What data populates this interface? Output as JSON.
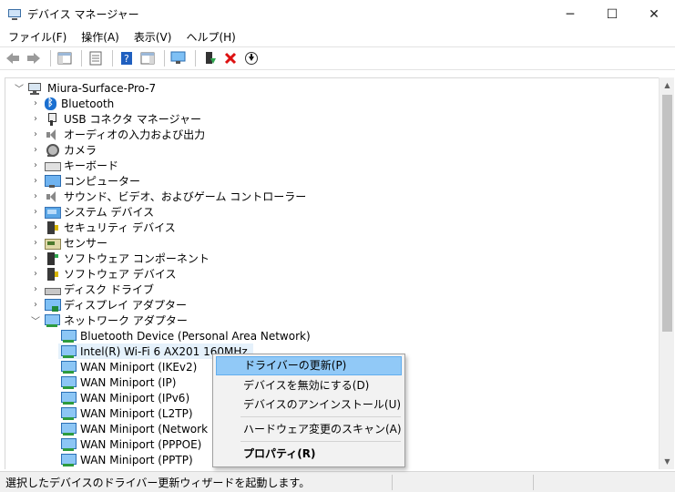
{
  "window": {
    "title": "デバイス マネージャー",
    "minimize": "─",
    "maximize": "☐",
    "close": "✕"
  },
  "menubar": [
    "ファイル(F)",
    "操作(A)",
    "表示(V)",
    "ヘルプ(H)"
  ],
  "toolbar": {
    "back": "back-arrow-icon",
    "forward": "forward-arrow-icon",
    "show_hide_tree": "tree-pane-icon",
    "properties": "properties-sheet-icon",
    "help": "help-icon",
    "action_pane": "action-pane-icon",
    "scan": "scan-hardware-icon",
    "update_driver": "update-driver-icon",
    "uninstall": "uninstall-x-icon",
    "download": "download-icon"
  },
  "tree": {
    "root": "Miura-Surface-Pro-7",
    "categories": [
      "Bluetooth",
      "USB コネクタ マネージャー",
      "オーディオの入力および出力",
      "カメラ",
      "キーボード",
      "コンピューター",
      "サウンド、ビデオ、およびゲーム コントローラー",
      "システム デバイス",
      "セキュリティ デバイス",
      "センサー",
      "ソフトウェア コンポーネント",
      "ソフトウェア デバイス",
      "ディスク ドライブ",
      "ディスプレイ アダプター",
      "ネットワーク アダプター"
    ],
    "network_children": [
      "Bluetooth Device (Personal Area Network)",
      "Intel(R) Wi-Fi 6 AX201 160MHz",
      "WAN Miniport (IKEv2)",
      "WAN Miniport (IP)",
      "WAN Miniport (IPv6)",
      "WAN Miniport (L2TP)",
      "WAN Miniport (Network Moni",
      "WAN Miniport (PPPOE)",
      "WAN Miniport (PPTP)"
    ]
  },
  "context_menu": {
    "update_driver": "ドライバーの更新(P)",
    "disable": "デバイスを無効にする(D)",
    "uninstall": "デバイスのアンインストール(U)",
    "scan": "ハードウェア変更のスキャン(A)",
    "properties": "プロパティ(R)"
  },
  "status": {
    "text": "選択したデバイスのドライバー更新ウィザードを起動します。"
  }
}
